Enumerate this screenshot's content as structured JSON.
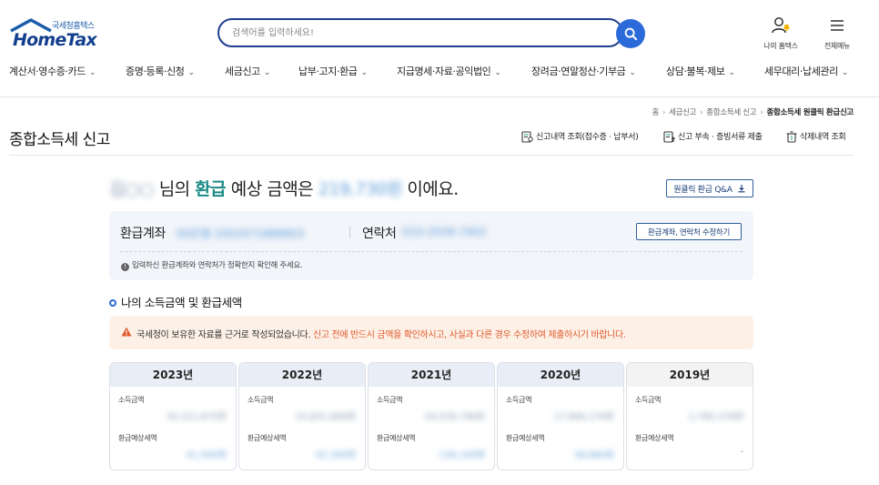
{
  "logo": {
    "sub": "국세청홈택스",
    "main": "HomeTax"
  },
  "search": {
    "placeholder": "검색어를 입력하세요!"
  },
  "header_icons": {
    "my_hometax": "나의 홈택스",
    "all_menu": "전체메뉴"
  },
  "gnb": [
    "계산서·영수증·카드",
    "증명·등록·신청",
    "세금신고",
    "납부·고지·환급",
    "지급명세·자료·공익법인",
    "장려금·연말정산·기부금",
    "상담·불복·제보",
    "세무대리·납세관리"
  ],
  "breadcrumb": [
    "홈",
    "세금신고",
    "종합소득세 신고",
    "종합소득세 원클릭 환급신고"
  ],
  "page_title": "종합소득세 신고",
  "top_links": [
    "신고내역 조회(접수증 · 납부서)",
    "신고 부속 · 증빙서류 제출",
    "삭제내역 조회"
  ],
  "headline": {
    "name": "김○○",
    "p1": "님의",
    "highlight": "환급",
    "p2": "예상 금액은",
    "amount": "219,730원",
    "p3": "이에요."
  },
  "qa_button": "원클릭 환급 Q&A",
  "account": {
    "account_label": "환급계좌",
    "account_value": "00은행 1002071888803",
    "contact_label": "연락처",
    "contact_value": "010-2939-7402",
    "edit_button": "환급계좌, 연락처 수정하기",
    "note": "입력하신 환급계좌와 연락처가 정확한지 확인해 주세요."
  },
  "section_title": "나의 소득금액 및 환급세액",
  "warning": {
    "normal": "국세청이 보유한 자료를 근거로 작성되었습니다.",
    "emphasis": "신고 전에 반드시 금액을 확인하시고, 사실과 다른 경우 수정하여 제출하시기 바랍니다."
  },
  "years": [
    {
      "year": "2023년",
      "income_label": "소득금액",
      "income": "34,312,675원",
      "refund_label": "환급예상세액",
      "refund": "41,930원"
    },
    {
      "year": "2022년",
      "income_label": "소득금액",
      "income": "33,831,608원",
      "refund_label": "환급예상세액",
      "refund": "42,350원"
    },
    {
      "year": "2021년",
      "income_label": "소득금액",
      "income": "29,536,796원",
      "refund_label": "환급예상세액",
      "refund": "136,100원"
    },
    {
      "year": "2020년",
      "income_label": "소득금액",
      "income": "17,899,176원",
      "refund_label": "환급예상세액",
      "refund": "38,860원"
    },
    {
      "year": "2019년",
      "income_label": "소득금액",
      "income": "2,785,376원",
      "refund_label": "환급예상세액",
      "refund": "-"
    }
  ],
  "colors": {
    "brand": "#133f8e",
    "accent": "#2a6bd9",
    "highlight": "#1a8a86",
    "warning": "#e0592a"
  }
}
